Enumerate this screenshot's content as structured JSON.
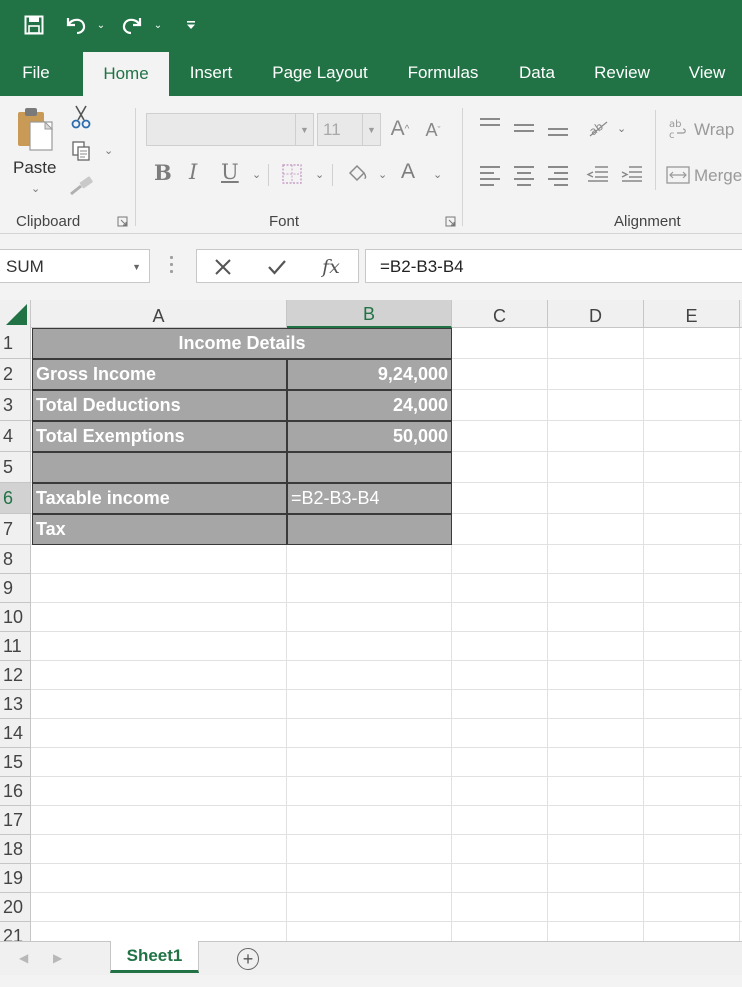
{
  "ribbon": {
    "tabs": [
      "File",
      "Home",
      "Insert",
      "Page Layout",
      "Formulas",
      "Data",
      "Review",
      "View"
    ],
    "active_tab": "Home",
    "clipboard": {
      "paste_label": "Paste",
      "group_label": "Clipboard"
    },
    "font": {
      "font_name": "",
      "font_size": "11",
      "group_label": "Font"
    },
    "alignment": {
      "wrap_label": "Wrap",
      "merge_label": "Merge",
      "group_label": "Alignment"
    }
  },
  "formula_bar": {
    "name_box": "SUM",
    "formula": "=B2-B3-B4"
  },
  "grid": {
    "columns": [
      "A",
      "B",
      "C",
      "D",
      "E"
    ],
    "rows": [
      "1",
      "2",
      "3",
      "4",
      "5",
      "6",
      "7",
      "8",
      "9",
      "10",
      "11",
      "12",
      "13",
      "14",
      "15",
      "16",
      "17",
      "18",
      "19",
      "20",
      "21"
    ],
    "cells": {
      "title": "Income Details",
      "a2": "Gross Income",
      "b2": "9,24,000",
      "a3": "Total Deductions",
      "b3": "24,000",
      "a4": "Total Exemptions",
      "b4": "50,000",
      "a6": "Taxable income",
      "b6": "=B2-B3-B4",
      "a7": "Tax"
    }
  },
  "sheets": {
    "tabs": [
      "Sheet1"
    ],
    "active": "Sheet1"
  },
  "colors": {
    "brand": "#217346",
    "table_fill": "#a6a6a6",
    "table_border": "#3a3a3a"
  }
}
